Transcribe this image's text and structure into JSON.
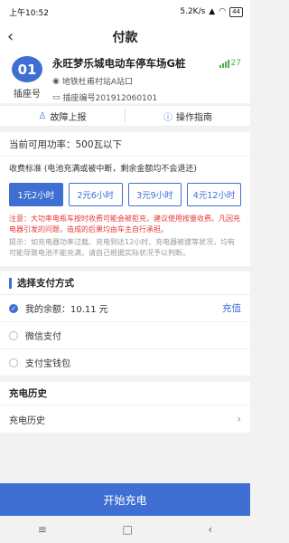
{
  "status_bar": {
    "time": "上午10:52",
    "speed": "5.2K/s",
    "battery": "44"
  },
  "header": {
    "back_icon": "chevron-left-icon",
    "title": "付款"
  },
  "station": {
    "socket_number": "01",
    "socket_label": "插座号",
    "name": "永旺梦乐城电动车停车场G桩",
    "signal_value": "27",
    "location": "地铁杜甫村站A站口",
    "socket_code": "插座编号201912060101"
  },
  "actions": {
    "report": "故障上报",
    "guide": "操作指南"
  },
  "power": {
    "text": "当前可用功率：500瓦以下"
  },
  "fee": {
    "title": "收费标准 (电池充满或被中断，剩余金额均不会退还)",
    "options": [
      "1元2小时",
      "2元6小时",
      "3元9小时",
      "4元12小时"
    ],
    "selected_index": 0,
    "notice": "注意：大功率电瓶车按时收费可能会被拒充，建议使用按量收费。凡因充电器引发的问题，造成的后果均由车主自行承担。",
    "tip": "提示：如充电器功率过载、充电到达12小时、充电器被拔等状况，均有可能导致电池不能充满，请自己根据实际状况予以判断。"
  },
  "payment": {
    "section_title": "选择支付方式",
    "balance_label": "我的余额：10.11 元",
    "recharge_label": "充值",
    "wechat_label": "微信支付",
    "alipay_label": "支付宝钱包"
  },
  "history": {
    "section_title": "充电历史",
    "row_label": "充电历史"
  },
  "start_button": "开始充电",
  "colors": {
    "accent": "#3f6fd2",
    "warning": "#e53935",
    "signal": "#4caf50"
  }
}
